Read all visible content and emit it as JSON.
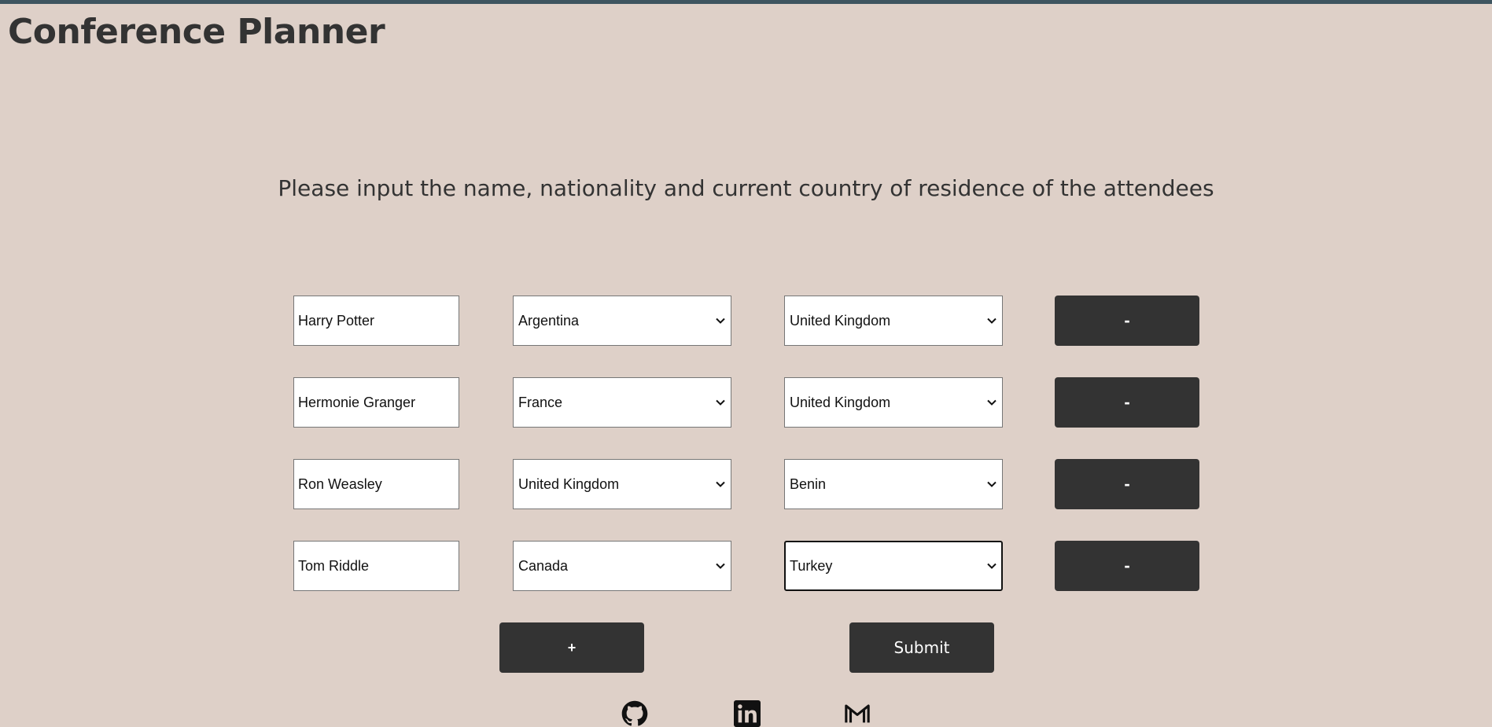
{
  "app": {
    "title": "Conference Planner"
  },
  "instructions": "Please input the name, nationality and current country of residence of the attendees",
  "attendees": [
    {
      "name": "Harry Potter",
      "nationality": "Argentina",
      "residence": "United Kingdom",
      "remove_label": "-"
    },
    {
      "name": "Hermonie Granger",
      "nationality": "France",
      "residence": "United Kingdom",
      "remove_label": "-"
    },
    {
      "name": "Ron Weasley",
      "nationality": "United Kingdom",
      "residence": "Benin",
      "remove_label": "-"
    },
    {
      "name": "Tom Riddle",
      "nationality": "Canada",
      "residence": "Turkey",
      "remove_label": "-"
    }
  ],
  "actions": {
    "add_label": "+",
    "submit_label": "Submit"
  },
  "footer": {
    "icons": [
      "github-icon",
      "linkedin-icon",
      "gmail-icon"
    ]
  },
  "colors": {
    "background": "#ded0c8",
    "top_bar": "#3e5560",
    "button": "#333333",
    "text": "#333333"
  }
}
